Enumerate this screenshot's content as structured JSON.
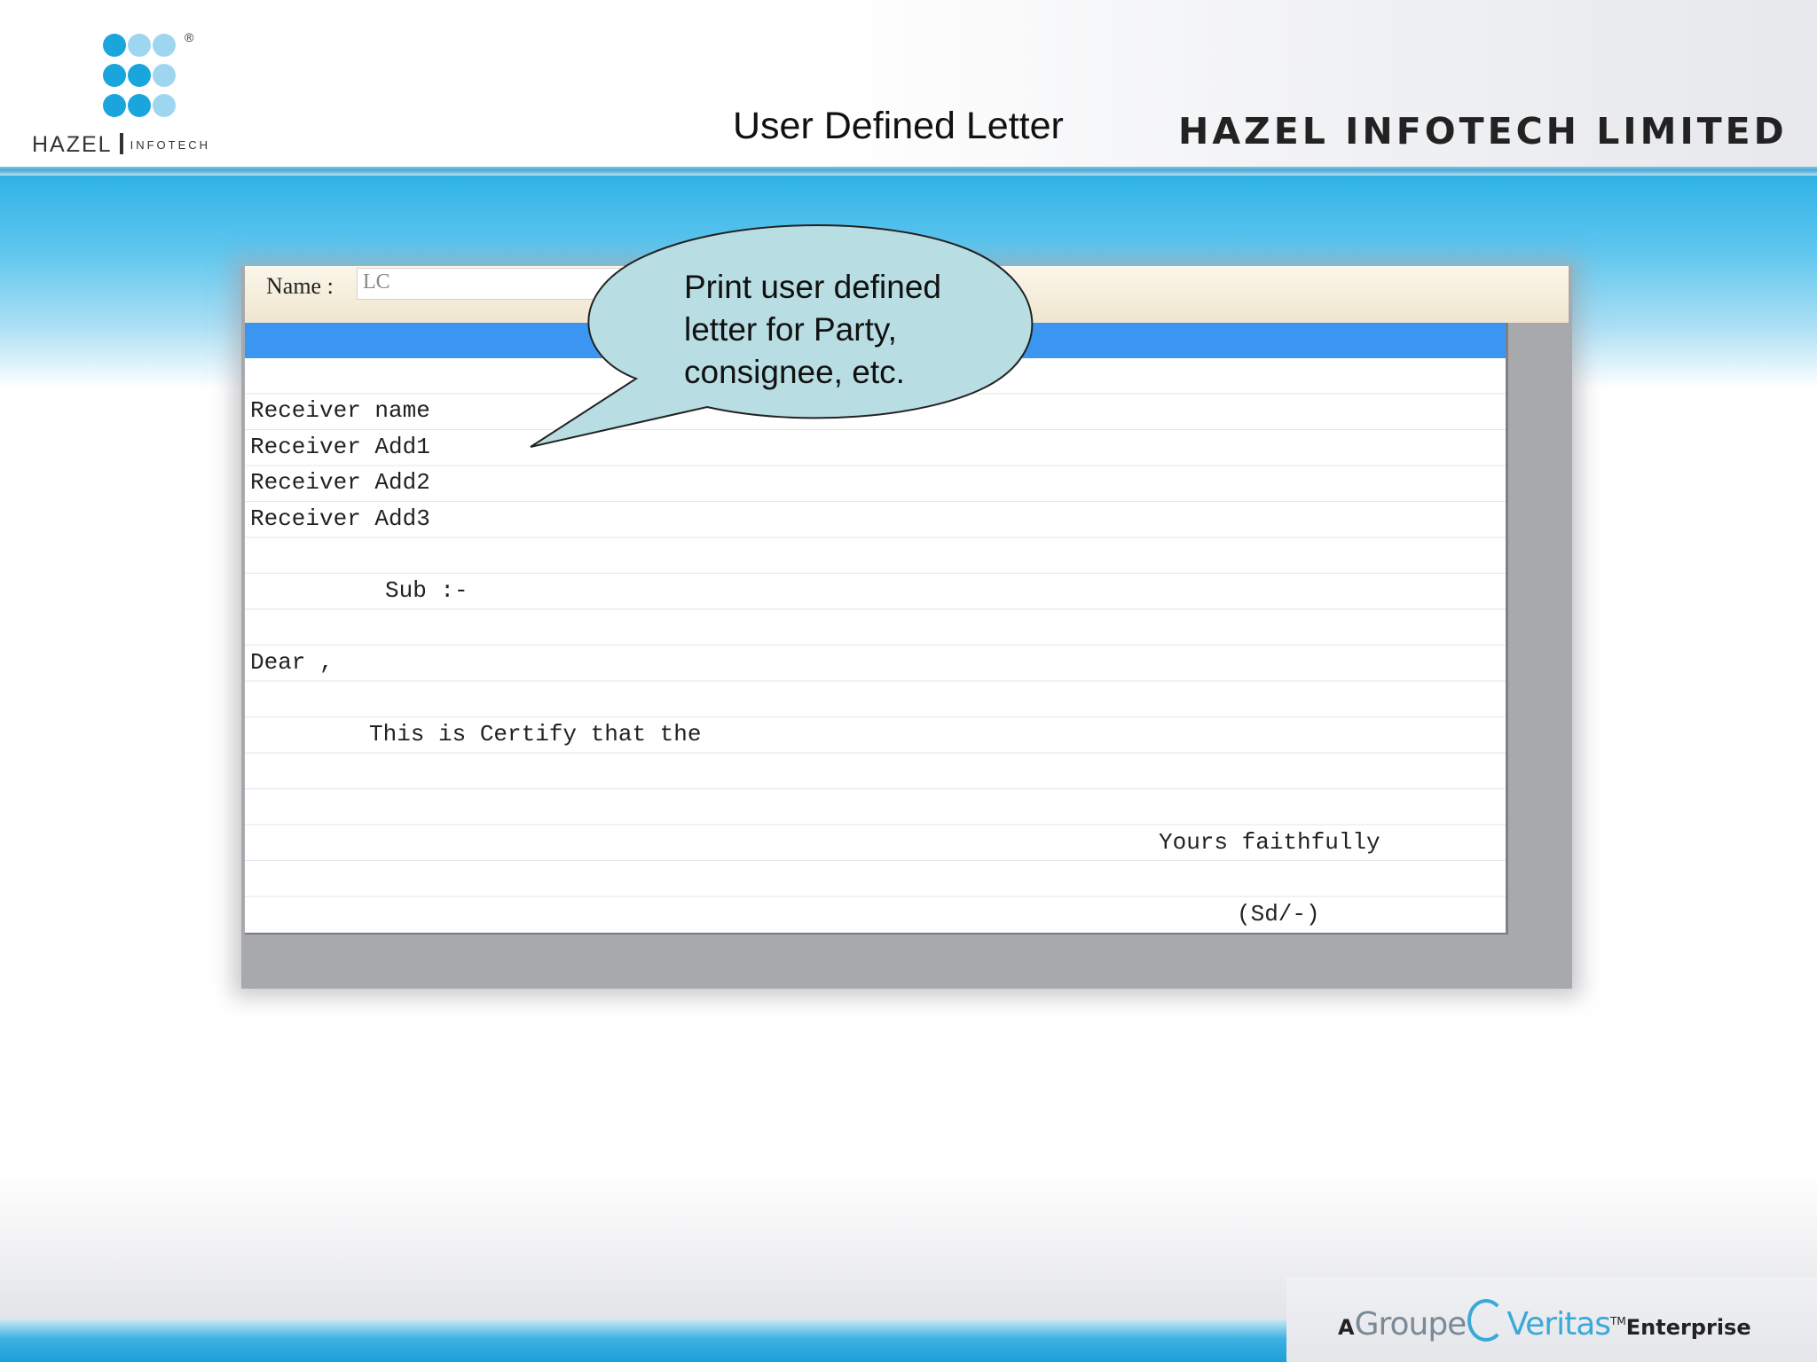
{
  "header": {
    "logo_name": "HAZEL",
    "logo_sub": "INFOTECH",
    "logo_reg": "®",
    "title": "User Defined Letter",
    "company": "HAZEL INFOTECH LIMITED"
  },
  "form": {
    "name_label": "Name :",
    "name_value": "LC"
  },
  "letter": {
    "rows": [
      "Receiver name",
      "Receiver Add1",
      "Receiver Add2",
      "Receiver Add3",
      "Sub :-",
      "Dear ,",
      "This is Certify that the",
      "Yours faithfully",
      "(Sd/-)"
    ]
  },
  "callout": {
    "lines": [
      "Print user defined",
      "letter for Party,",
      "consignee, etc."
    ]
  },
  "footer": {
    "prefix": "A",
    "brand1": "Groupe",
    "brand2": "Veritas",
    "tm": "TM",
    "suffix": "Enterprise"
  },
  "colors": {
    "accent_blue": "#3a96f0",
    "callout_fill": "#b8dde2",
    "logo_blue": "#1aa6dc",
    "logo_light": "#9fd6ef"
  }
}
